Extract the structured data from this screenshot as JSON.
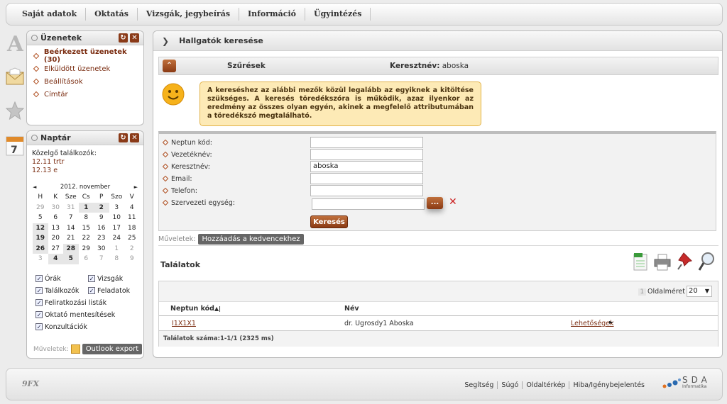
{
  "topmenu": [
    "Saját adatok",
    "Oktatás",
    "Vizsgák, jegybeírás",
    "Információ",
    "Ügyintézés"
  ],
  "messages": {
    "title": "Üzenetek",
    "items": [
      "Beérkezett üzenetek (30)",
      "Elküldött üzenetek",
      "Beállítások",
      "Címtár"
    ]
  },
  "calendar": {
    "title": "Naptár",
    "upcoming_label": "Közelgő találkozók:",
    "upcoming": [
      "12.11 trtr",
      "12.13 e"
    ],
    "month": "2012. november",
    "prev": "◄",
    "next": "►",
    "weekdays": [
      "H",
      "K",
      "Sze",
      "Cs",
      "P",
      "Szo",
      "V"
    ],
    "weeks": [
      [
        "29",
        "30",
        "31",
        "1",
        "2",
        "3",
        "4"
      ],
      [
        "5",
        "6",
        "7",
        "8",
        "9",
        "10",
        "11"
      ],
      [
        "12",
        "13",
        "14",
        "15",
        "16",
        "17",
        "18"
      ],
      [
        "19",
        "20",
        "21",
        "22",
        "23",
        "24",
        "25"
      ],
      [
        "26",
        "27",
        "28",
        "29",
        "30",
        "1",
        "2"
      ],
      [
        "3",
        "4",
        "5",
        "6",
        "7",
        "8",
        "9"
      ]
    ],
    "checkboxes": [
      {
        "label": "Órák",
        "checked": true
      },
      {
        "label": "Vizsgák",
        "checked": true
      },
      {
        "label": "Találkozók",
        "checked": true
      },
      {
        "label": "Feladatok",
        "checked": true
      },
      {
        "label": "Feliratkozási listák",
        "checked": true
      },
      {
        "label": "Oktató mentesítések",
        "checked": true
      },
      {
        "label": "Konzultációk",
        "checked": true
      }
    ],
    "ops_label": "Műveletek:",
    "export_btn": "Outlook export"
  },
  "main": {
    "title": "Hallgatók keresése",
    "filters_label": "Szűrések",
    "filter_key": "Keresztnév:",
    "filter_value": "aboska",
    "tooltip": "A kereséshez az alábbi mezők közül legalább az egyiknek a kitöltése szükséges. A keresés töredékszóra is működik, azaz ilyenkor az eredmény az összes olyan egyén, akinek a megfelelő attributumában a töredékszó megtalálható.",
    "fields": [
      {
        "label": "Neptun kód:",
        "value": ""
      },
      {
        "label": "Vezetéknév:",
        "value": ""
      },
      {
        "label": "Keresztnév:",
        "value": "aboska"
      },
      {
        "label": "Email:",
        "value": ""
      },
      {
        "label": "Telefon:",
        "value": ""
      },
      {
        "label": "Szervezeti egység:",
        "value": ""
      }
    ],
    "org_btn": "...",
    "search_btn": "Keresés",
    "ops_label": "Műveletek:",
    "fav_btn": "Hozzáadás a kedvencekhez",
    "results_title": "Találatok",
    "page_num": "1",
    "page_size_label": "Oldalméret",
    "page_size": "20",
    "columns": [
      "Neptun kód",
      "Név"
    ],
    "rows": [
      {
        "code": "I1X1X1",
        "name": "dr. Ugrosdy1 Aboska",
        "action": "Lehetőségek"
      }
    ],
    "result_count": "Találatok száma:1-1/1 (2325 ms)"
  },
  "footer": {
    "logo": "9FX",
    "links": [
      "Segítség",
      "Súgó",
      "Oldaltérkép",
      "Hiba/Igénybejelentés"
    ],
    "brand": "SDA",
    "brand_sub": "Informatika"
  }
}
